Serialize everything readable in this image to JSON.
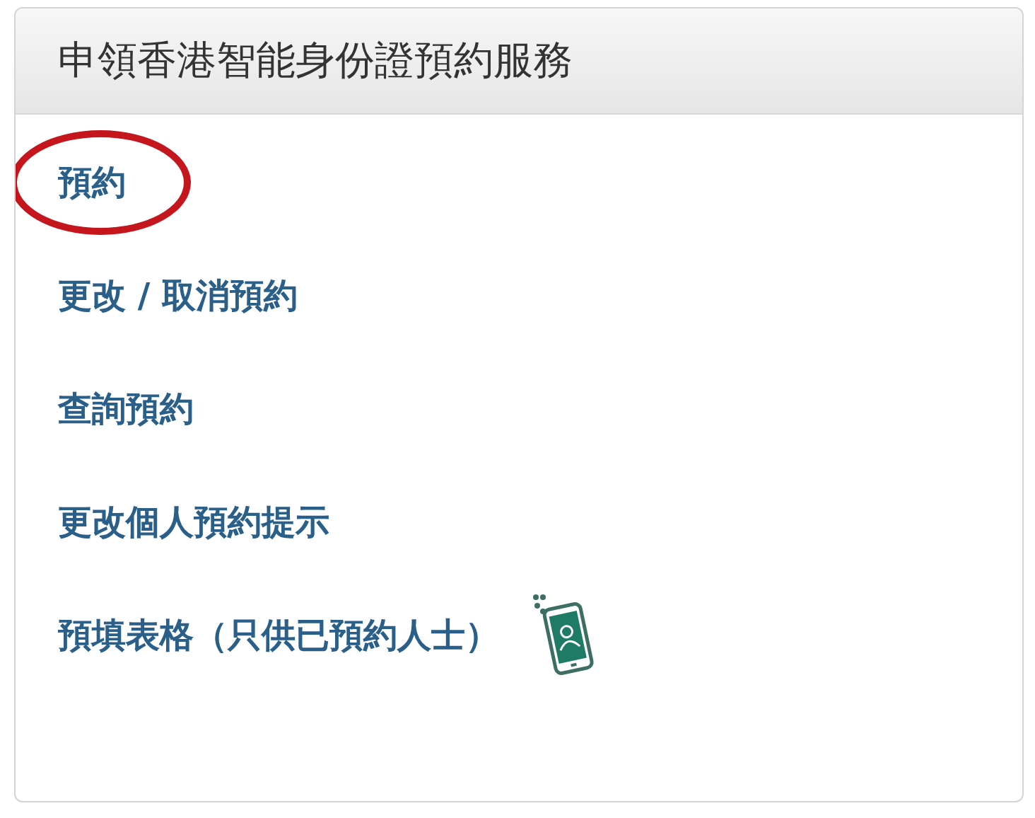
{
  "panel": {
    "title": "申領香港智能身份證預約服務"
  },
  "links": [
    {
      "label": "預約",
      "circled": true,
      "kind": "plain"
    },
    {
      "label": "更改 / 取消預約",
      "circled": false,
      "kind": "plain"
    },
    {
      "label": "查詢預約",
      "circled": false,
      "kind": "plain"
    },
    {
      "label": "更改個人預約提示",
      "circled": false,
      "kind": "plain"
    },
    {
      "label": "預填表格（只供已預約人士）",
      "circled": false,
      "kind": "with-phone-icon"
    }
  ]
}
